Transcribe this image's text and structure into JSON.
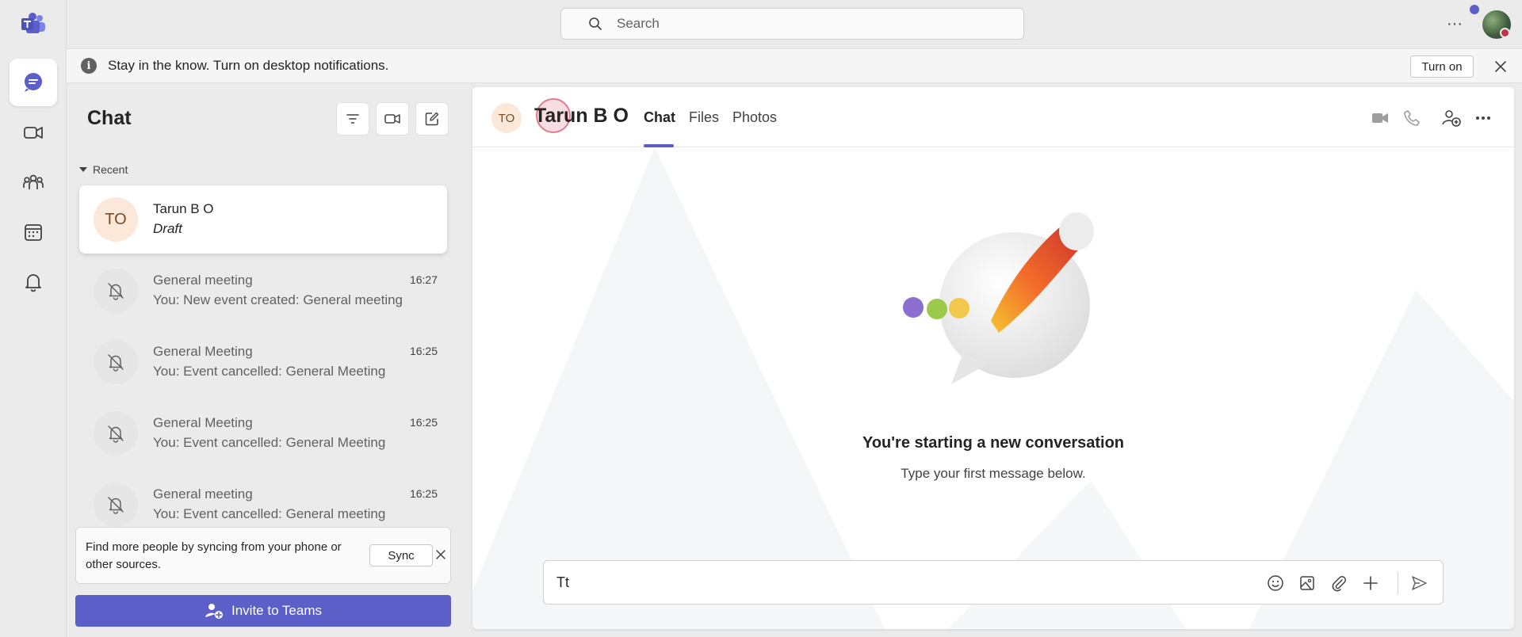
{
  "app": {
    "name": "Microsoft Teams",
    "brand_color": "#5b5fc7"
  },
  "rail": {
    "items": [
      {
        "id": "chat",
        "icon": "chat-icon",
        "active": true
      },
      {
        "id": "meet",
        "icon": "video-camera-icon",
        "active": false
      },
      {
        "id": "teams",
        "icon": "people-icon",
        "active": false
      },
      {
        "id": "calendar",
        "icon": "calendar-icon",
        "active": false
      },
      {
        "id": "activity",
        "icon": "bell-icon",
        "active": false
      }
    ]
  },
  "topbar": {
    "search": {
      "placeholder": "Search",
      "icon": "search-icon"
    },
    "more_icon": "more-horizontal-icon",
    "status_color": "#c4314b"
  },
  "banner": {
    "text": "Stay in the know. Turn on desktop notifications.",
    "action_label": "Turn on",
    "icon": "info-icon"
  },
  "chat_panel": {
    "title": "Chat",
    "tools": [
      "filter-icon",
      "video-camera-icon",
      "compose-icon"
    ],
    "section_label": "Recent",
    "items": [
      {
        "initials": "TO",
        "name": "Tarun B O",
        "subtitle": "Draft",
        "time": "",
        "selected": true
      },
      {
        "name": "General meeting",
        "subtitle": "You: New event created: General meeting",
        "time": "16:27",
        "icon": "bell-off-icon"
      },
      {
        "name": "General Meeting",
        "subtitle": "You: Event cancelled: General Meeting",
        "time": "16:25",
        "icon": "bell-off-icon"
      },
      {
        "name": "General Meeting",
        "subtitle": "You: Event cancelled: General Meeting",
        "time": "16:25",
        "icon": "bell-off-icon"
      },
      {
        "name": "General meeting",
        "subtitle": "You: Event cancelled: General meeting",
        "time": "16:25",
        "icon": "bell-off-icon"
      }
    ],
    "sync_card": {
      "text": "Find more people by syncing from your phone or other sources.",
      "button_label": "Sync"
    },
    "invite_label": "Invite to Teams"
  },
  "conversation": {
    "initials": "TO",
    "name": "Tarun B O",
    "tabs": [
      {
        "label": "Chat",
        "active": true
      },
      {
        "label": "Files",
        "active": false
      },
      {
        "label": "Photos",
        "active": false
      }
    ],
    "header_icons": [
      "video-call-icon",
      "phone-icon",
      "add-people-icon",
      "more-horizontal-icon"
    ],
    "empty_state": {
      "title": "You're starting a new conversation",
      "subtitle": "Type your first message below."
    },
    "composer": {
      "value": "Tt",
      "icons": [
        "emoji-icon",
        "image-icon",
        "attach-icon",
        "plus-icon",
        "send-icon"
      ]
    }
  }
}
